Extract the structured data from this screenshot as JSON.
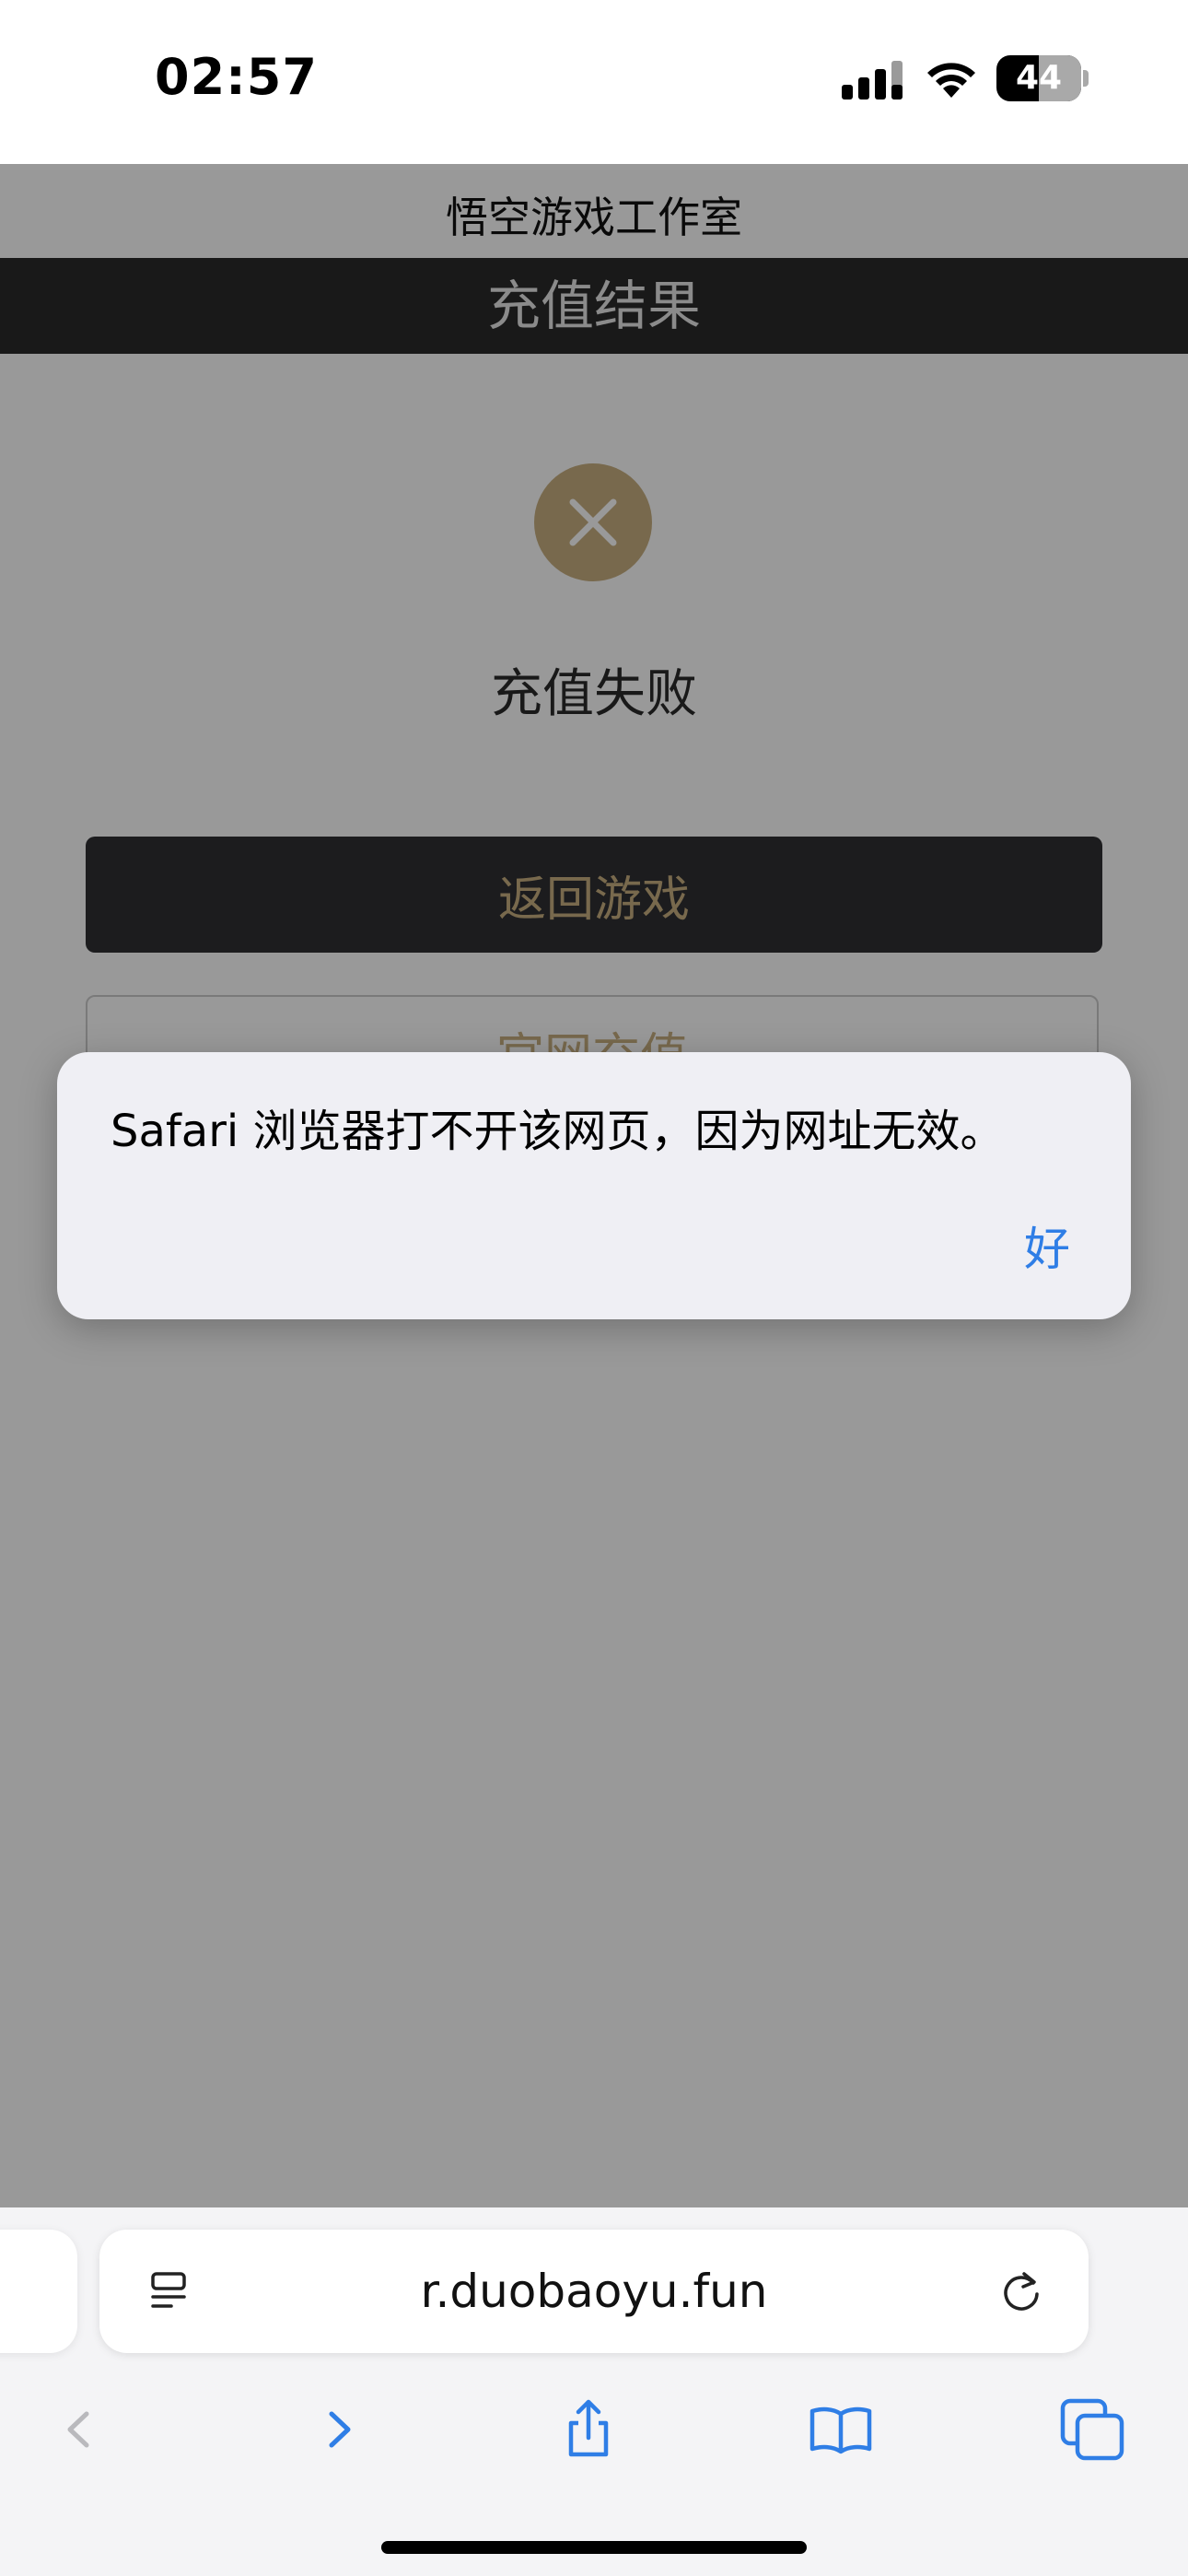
{
  "status_bar": {
    "time": "02:57",
    "battery": "44"
  },
  "page": {
    "site_title": "悟空游戏工作室",
    "result_title": "充值结果",
    "status_text": "充值失败",
    "back_button": "返回游戏",
    "recharge_button": "官网充值"
  },
  "alert": {
    "message": "Safari 浏览器打不开该网页，因为网址无效。",
    "ok_label": "好"
  },
  "safari": {
    "url": "r.duobaoyu.fun"
  },
  "colors": {
    "accent_gold": "#c9b080",
    "link_blue": "#2f7ee6",
    "dark_bar": "#2b2b2b"
  }
}
